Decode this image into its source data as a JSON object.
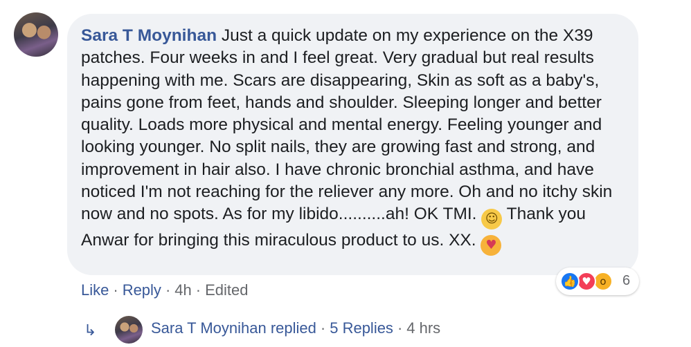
{
  "comment": {
    "author": "Sara T Moynihan",
    "text_part1": " Just a quick update on my experience on the X39 patches. Four weeks in and I feel great. Very gradual but real results happening with me. Scars are disappearing, Skin as soft as a baby's, pains gone from feet, hands and shoulder. Sleeping longer and better quality. Loads more physical and mental energy. Feeling younger and looking younger. No split nails, they are growing fast and strong, and improvement in hair also. I have chronic bronchial asthma, and have noticed I'm not reaching for the reliever any more. Oh and no itchy skin now and no spots. As for my libido..........ah! OK TMI. ",
    "text_part2": " Thank you Anwar for bringing this miraculous product to us. XX. ",
    "emoji1": "winking-face",
    "emoji2": "smiling-face-with-hearts"
  },
  "reactions": {
    "count": "6",
    "icons": [
      "like",
      "love",
      "wow"
    ]
  },
  "actions": {
    "like": "Like",
    "reply": "Reply",
    "time": "4h",
    "edited": "Edited",
    "separator": "·"
  },
  "replies": {
    "author_replied": "Sara T Moynihan replied",
    "count_label": "5 Replies",
    "time": "4 hrs",
    "separator": "·"
  }
}
